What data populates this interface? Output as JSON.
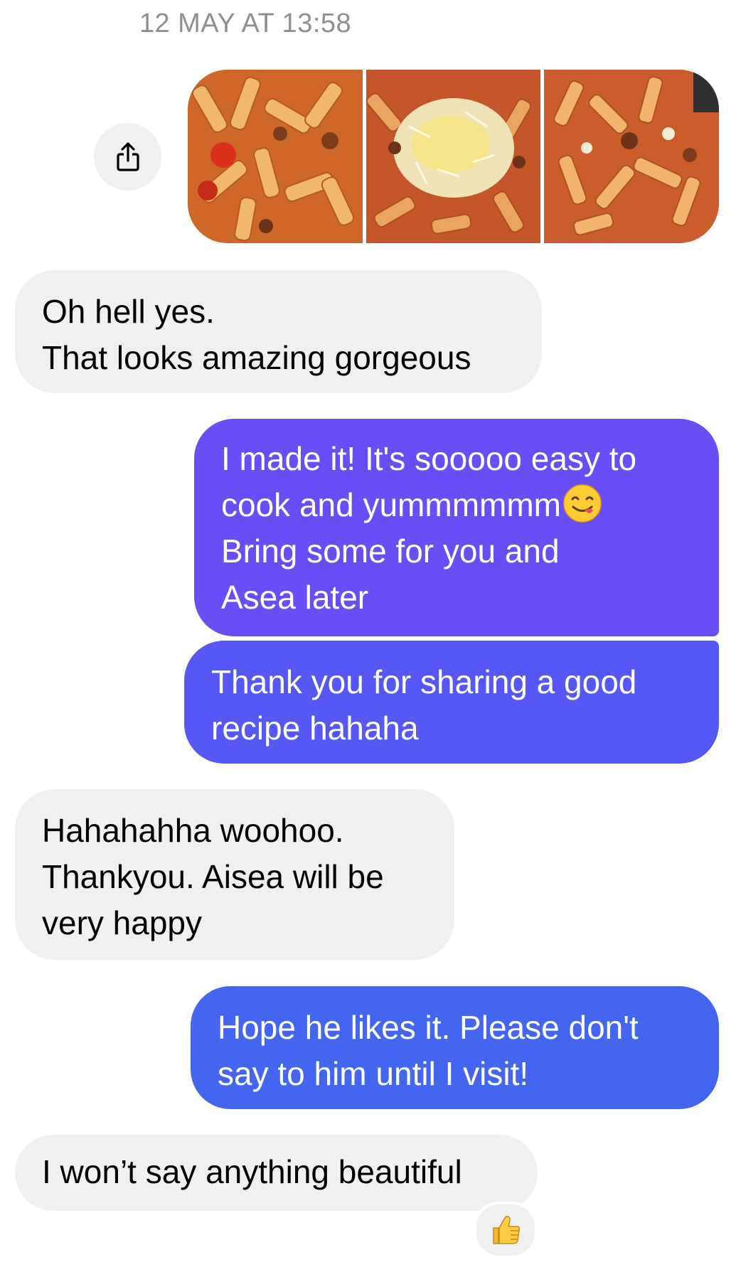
{
  "conversation": {
    "timestamp": "12 MAY AT 13:58",
    "shared_photos": {
      "count": 3,
      "share_icon": "share-icon"
    },
    "messages": [
      {
        "sender": "them",
        "text": "Oh hell yes.\nThat looks amazing gorgeous"
      },
      {
        "sender": "me",
        "text": "I made it! It's sooooo easy to\ncook and yummmmmm",
        "text_after_emoji": "\nBring some for you and\nAsea later",
        "emoji": "face-savoring-food-emoji"
      },
      {
        "sender": "me",
        "text": "Thank you for sharing a good\nrecipe hahaha"
      },
      {
        "sender": "them",
        "text": "Hahahahha woohoo.\nThankyou. Aisea will be\nvery happy"
      },
      {
        "sender": "me",
        "text": "Hope he likes it. Please don't\nsay to him until I visit!"
      },
      {
        "sender": "them",
        "text": "I won’t say anything beautiful",
        "reaction": "thumbs-up-emoji"
      }
    ]
  },
  "colors": {
    "incoming_bubble": "#f0f0f0",
    "outgoing_bubble_1": "#6a4ef5",
    "outgoing_bubble_2": "#5558f4",
    "outgoing_bubble_3": "#4465f0",
    "timestamp_text": "#8e8e93"
  }
}
